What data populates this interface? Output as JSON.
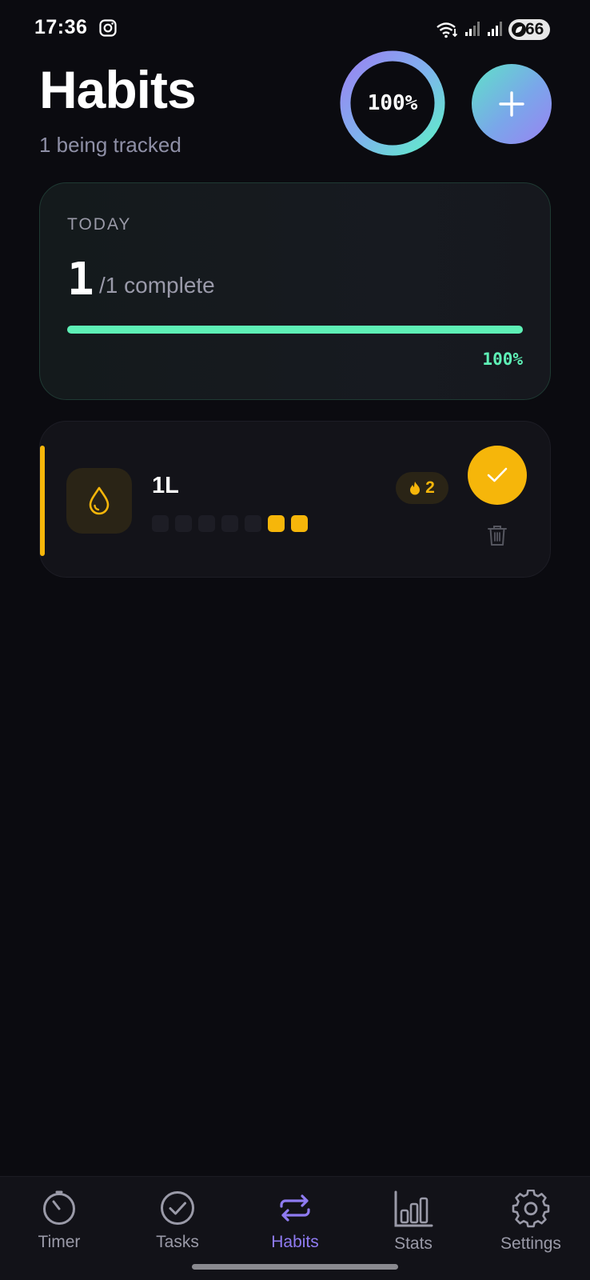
{
  "status_bar": {
    "time": "17:36",
    "battery_level": "66",
    "icons": [
      "instagram-icon",
      "wifi-icon",
      "signal-icon",
      "signal-icon",
      "battery-saver-leaf-icon"
    ]
  },
  "header": {
    "title": "Habits",
    "subtitle": "1 being tracked",
    "overall_percent_label": "100%",
    "overall_progress": 1.0,
    "add_icon": "plus-icon"
  },
  "today": {
    "label": "TODAY",
    "completed": "1",
    "total_suffix": "/1 complete",
    "progress": 1.0,
    "percent_label": "100%"
  },
  "habits": [
    {
      "name": "1L",
      "icon": "water-drop-icon",
      "streak": "2",
      "streak_icon": "flame-icon",
      "history": [
        false,
        false,
        false,
        false,
        false,
        true,
        true
      ],
      "done": true
    }
  ],
  "nav": {
    "items": [
      {
        "label": "Timer",
        "icon": "timer-icon",
        "active": false
      },
      {
        "label": "Tasks",
        "icon": "check-circle-icon",
        "active": false
      },
      {
        "label": "Habits",
        "icon": "repeat-icon",
        "active": true
      },
      {
        "label": "Stats",
        "icon": "bar-chart-icon",
        "active": false
      },
      {
        "label": "Settings",
        "icon": "gear-icon",
        "active": false
      }
    ]
  },
  "colors": {
    "background": "#0b0b10",
    "accent_yellow": "#f6b60a",
    "accent_green": "#5ef0b6",
    "accent_purple": "#8f7bf2"
  }
}
